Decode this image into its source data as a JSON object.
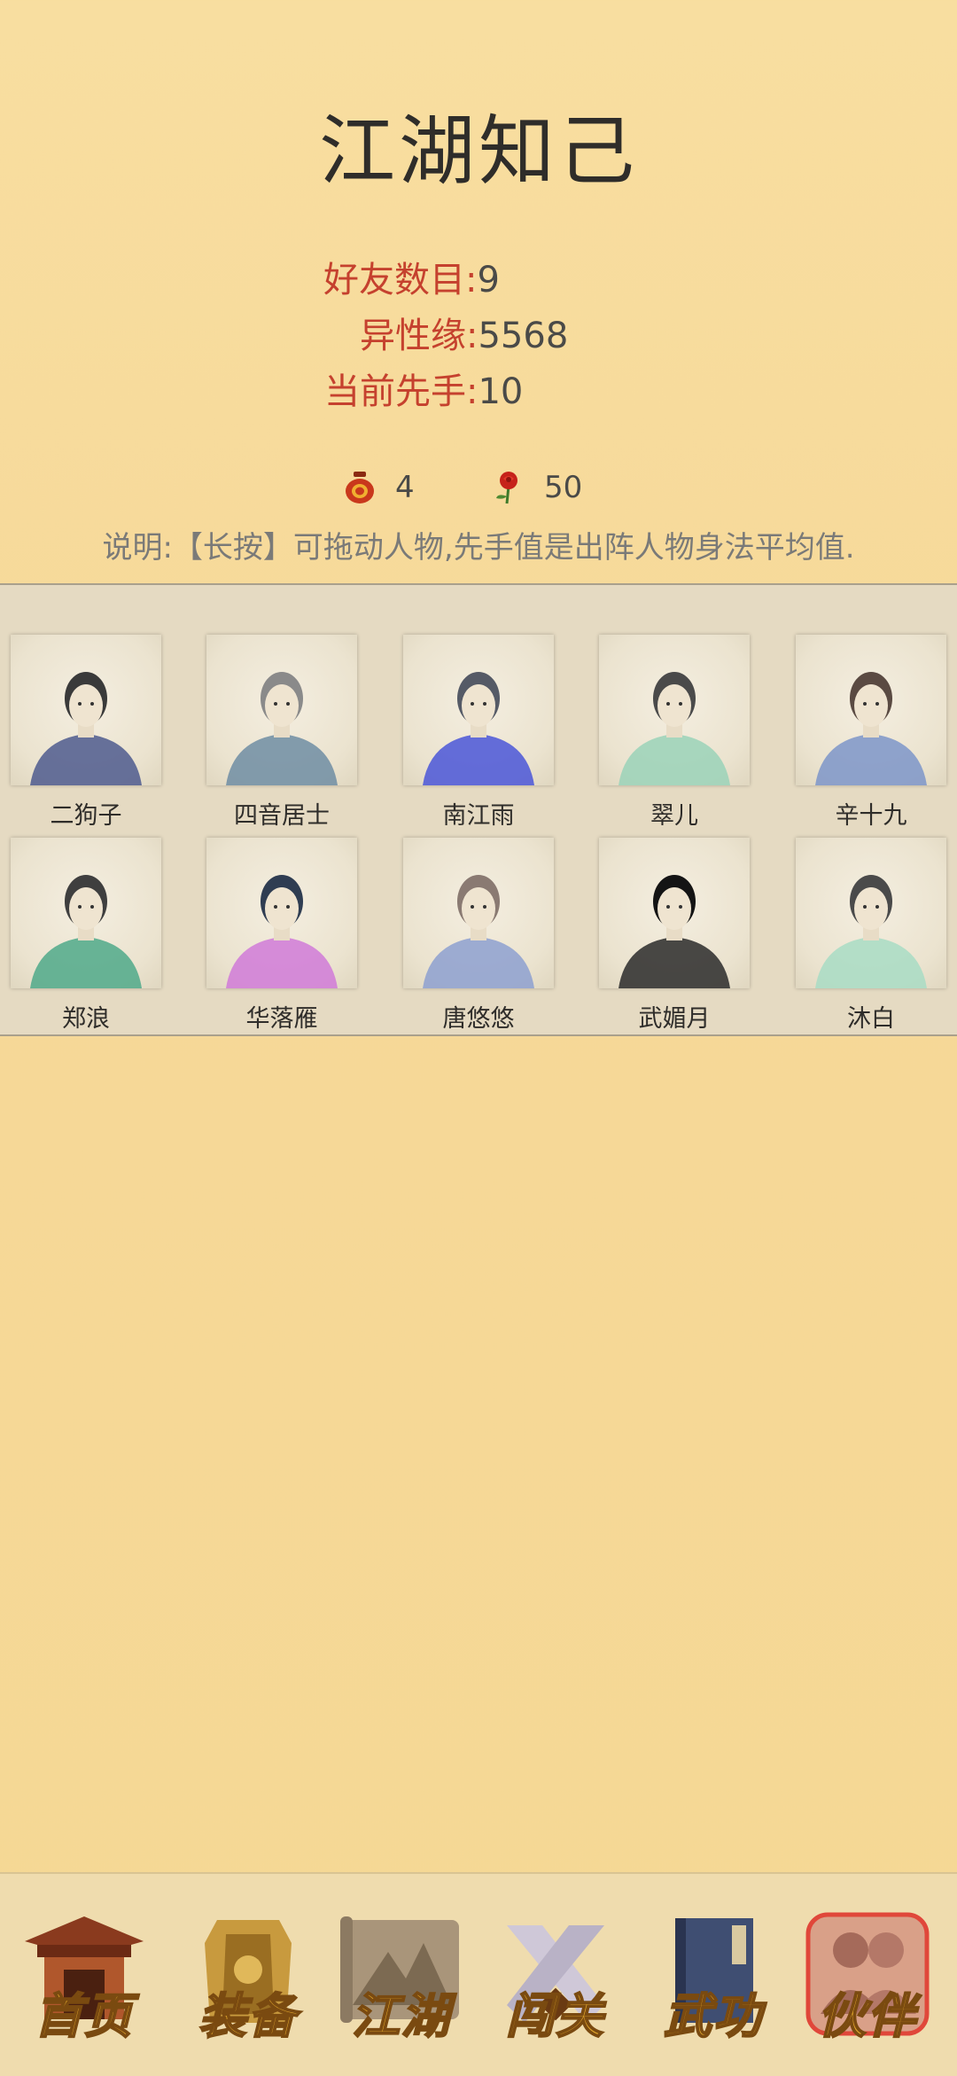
{
  "header": {
    "title": "江湖知己"
  },
  "stats": [
    {
      "label": "好友数目:",
      "value": "9"
    },
    {
      "label": "异性缘:",
      "value": "5568"
    },
    {
      "label": "当前先手:",
      "value": "10"
    }
  ],
  "resources": [
    {
      "icon": "wine-jar-icon",
      "value": "4"
    },
    {
      "icon": "rose-icon",
      "value": "50"
    }
  ],
  "note": "说明:【长按】可拖动人物,先手值是出阵人物身法平均值.",
  "characters": [
    {
      "name": "二狗子",
      "robe": "#4d5a8e",
      "hair": "#3a3a3a"
    },
    {
      "name": "四音居士",
      "robe": "#6e8da3",
      "hair": "#8a8a8a"
    },
    {
      "name": "南江雨",
      "robe": "#4a56d8",
      "hair": "#555a66"
    },
    {
      "name": "翠儿",
      "robe": "#9ad2b8",
      "hair": "#4a4a4a"
    },
    {
      "name": "辛十九",
      "robe": "#7c95c9",
      "hair": "#5a4a42"
    },
    {
      "name": "郑浪",
      "robe": "#4fa98a",
      "hair": "#3f3f3f"
    },
    {
      "name": "华落雁",
      "robe": "#d07ad8",
      "hair": "#2f3d52"
    },
    {
      "name": "唐悠悠",
      "robe": "#8da0d0",
      "hair": "#8a7a72"
    },
    {
      "name": "武媚月",
      "robe": "#2a2a2a",
      "hair": "#141414"
    },
    {
      "name": "沐白",
      "robe": "#a8dcc4",
      "hair": "#4a4a4a"
    }
  ],
  "nav": [
    {
      "label": "首页",
      "icon": "home-pavilion-icon"
    },
    {
      "label": "装备",
      "icon": "armor-icon"
    },
    {
      "label": "江湖",
      "icon": "map-scroll-icon"
    },
    {
      "label": "闯关",
      "icon": "crossed-swords-icon"
    },
    {
      "label": "武功",
      "icon": "martial-book-icon"
    },
    {
      "label": "伙伴",
      "icon": "companions-icon"
    }
  ],
  "nav_active": "伙伴",
  "colors": {
    "label_red": "#c5412e",
    "value_gray": "#4a4a48",
    "nav_gold": "#e0a52c"
  }
}
